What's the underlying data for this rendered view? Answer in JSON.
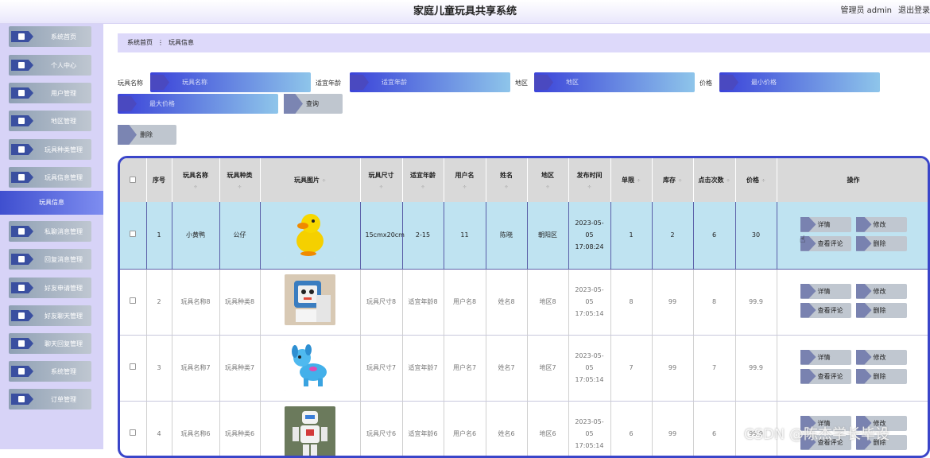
{
  "header": {
    "title": "家庭儿童玩具共享系统",
    "user_label": "管理员 admin",
    "logout_label": "退出登录"
  },
  "sidebar": {
    "items": [
      {
        "label": "系统首页",
        "icon": "home-icon"
      },
      {
        "label": "个人中心",
        "icon": "user-icon"
      },
      {
        "label": "用户管理",
        "icon": "list-icon"
      },
      {
        "label": "地区管理",
        "icon": "chart-icon"
      },
      {
        "label": "玩具种类管理",
        "icon": "grid-icon"
      },
      {
        "label": "玩具信息管理",
        "icon": "user-icon"
      },
      {
        "label": "私聊消息管理",
        "icon": "grid-icon"
      },
      {
        "label": "回复消息管理",
        "icon": "grid-icon"
      },
      {
        "label": "好友申请管理",
        "icon": "grid-icon"
      },
      {
        "label": "好友聊天管理",
        "icon": "doc-icon"
      },
      {
        "label": "聊天回复管理",
        "icon": "doc-icon"
      },
      {
        "label": "系统管理",
        "icon": "chat-icon"
      },
      {
        "label": "订单管理",
        "icon": "book-icon"
      }
    ],
    "active_sub": "玩具信息"
  },
  "breadcrumb": {
    "home": "系统首页",
    "separator": "⋮",
    "current": "玩具信息"
  },
  "filters": {
    "name_label": "玩具名称",
    "name_placeholder": "玩具名称",
    "age_label": "适宜年龄",
    "age_placeholder": "适宜年龄",
    "region_label": "地区",
    "region_placeholder": "地区",
    "price_label": "价格",
    "min_price_placeholder": "最小价格",
    "max_price_placeholder": "最大价格",
    "search_button": "查询",
    "delete_button": "删除"
  },
  "table": {
    "columns": [
      "序号",
      "玩具名称",
      "玩具种类",
      "玩具图片",
      "玩具尺寸",
      "适宜年龄",
      "用户名",
      "姓名",
      "地区",
      "发布时间",
      "单限",
      "库存",
      "点击次数",
      "价格",
      "操作"
    ],
    "sort_arrow": "÷",
    "rows": [
      {
        "no": "1",
        "name": "小黄鸭",
        "type": "公仔",
        "pic": "duck",
        "size": "15cmx20cm",
        "age": "2-15",
        "username": "11",
        "realname": "陈晓",
        "region": "朝阳区",
        "time": "2023-05-05 17:08:24",
        "limit": "1",
        "stock": "2",
        "clicks": "6",
        "price": "30"
      },
      {
        "no": "2",
        "name": "玩具名称8",
        "type": "玩具种类8",
        "pic": "robot-box",
        "size": "玩具尺寸8",
        "age": "适宜年龄8",
        "username": "用户名8",
        "realname": "姓名8",
        "region": "地区8",
        "time": "2023-05-05 17:05:14",
        "limit": "8",
        "stock": "99",
        "clicks": "8",
        "price": "99.9"
      },
      {
        "no": "3",
        "name": "玩具名称7",
        "type": "玩具种类7",
        "pic": "dog",
        "size": "玩具尺寸7",
        "age": "适宜年龄7",
        "username": "用户名7",
        "realname": "姓名7",
        "region": "地区7",
        "time": "2023-05-05 17:05:14",
        "limit": "7",
        "stock": "99",
        "clicks": "7",
        "price": "99.9"
      },
      {
        "no": "4",
        "name": "玩具名称6",
        "type": "玩具种类6",
        "pic": "robot",
        "size": "玩具尺寸6",
        "age": "适宜年龄6",
        "username": "用户名6",
        "realname": "姓名6",
        "region": "地区6",
        "time": "2023-05-05 17:05:14",
        "limit": "6",
        "stock": "99",
        "clicks": "6",
        "price": "99.9"
      }
    ],
    "actions": {
      "detail": "详情",
      "edit": "修改",
      "comments": "查看评论",
      "delete": "删除"
    }
  },
  "watermark": "CSDN @陈杰学长毕设"
}
